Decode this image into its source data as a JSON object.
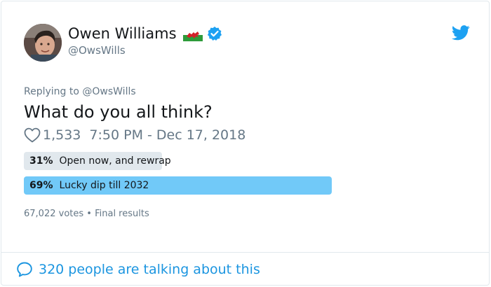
{
  "author": {
    "name": "Owen Williams",
    "handle": "@OwsWills"
  },
  "icons": {
    "flag": "wales-flag-icon",
    "verified": "verified-badge-icon",
    "bird": "twitter-bird-icon",
    "heart": "heart-icon",
    "bubble": "speech-bubble-icon"
  },
  "replying": "Replying to @OwsWills",
  "tweet": {
    "text": "What do you all think?",
    "likes": "1,533",
    "timestamp": "7:50 PM - Dec 17, 2018"
  },
  "poll": {
    "options": [
      {
        "percent_label": "31%",
        "label": "Open now, and rewrap",
        "percent": 31
      },
      {
        "percent_label": "69%",
        "label": "Lucky dip till 2032",
        "percent": 69
      }
    ],
    "votes": "67,022 votes",
    "separator": "•",
    "status": "Final results"
  },
  "footer": {
    "talking": "320 people are talking about this"
  },
  "colors": {
    "accent": "#1b95e0",
    "verified": "#1da1f2",
    "winner_bar": "#71c9f8",
    "loser_bar": "#e1e8ed",
    "secondary_text": "#657786"
  }
}
